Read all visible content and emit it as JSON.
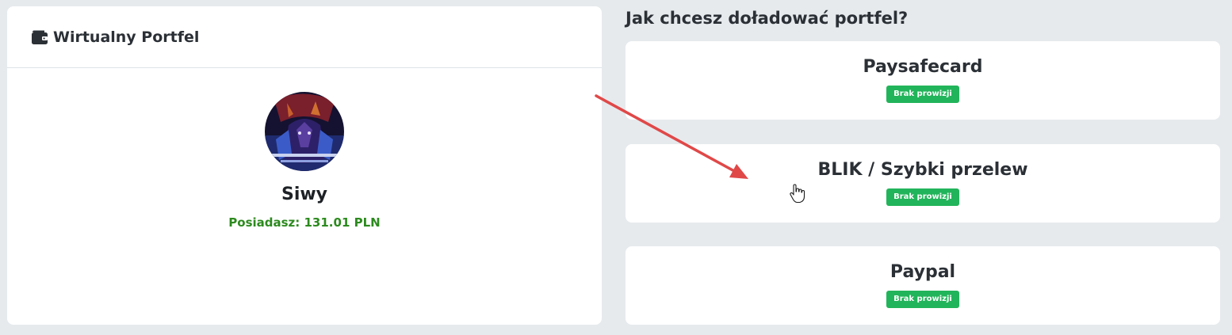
{
  "wallet": {
    "title": "Wirtualny Portfel",
    "icon": "wallet-icon",
    "username": "Siwy",
    "balance_text": "Posiadasz: 131.01 PLN"
  },
  "topup": {
    "heading": "Jak chcesz doładować portfel?",
    "methods": [
      {
        "name": "Paysafecard",
        "badge": "Brak prowizji"
      },
      {
        "name": "BLIK / Szybki przelew",
        "badge": "Brak prowizji"
      },
      {
        "name": "Paypal",
        "badge": "Brak prowizji"
      }
    ]
  },
  "colors": {
    "background": "#e6eaed",
    "balance_green": "#2c8a1e",
    "badge_green": "#22b45a",
    "annotation_arrow": "#e04848"
  }
}
